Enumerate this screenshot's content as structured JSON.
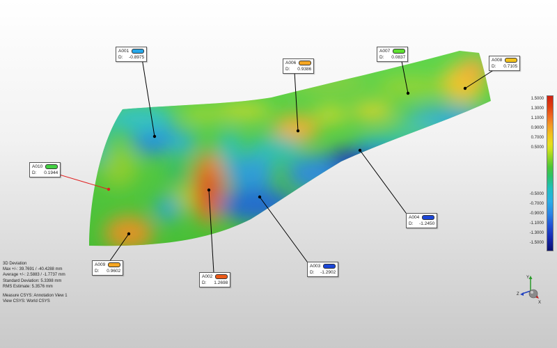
{
  "callouts": [
    {
      "id": "A001",
      "label": "A001",
      "d_label": "D:",
      "value": "-0.8975",
      "color": "#27a7e8"
    },
    {
      "id": "A006",
      "label": "A006",
      "d_label": "D:",
      "value": "0.9386",
      "color": "#f5a623"
    },
    {
      "id": "A007",
      "label": "A007",
      "d_label": "D:",
      "value": "0.0837",
      "color": "#5ee030"
    },
    {
      "id": "A008",
      "label": "A008",
      "d_label": "D:",
      "value": "0.7105",
      "color": "#f2c21d"
    },
    {
      "id": "A010",
      "label": "A010",
      "d_label": "D:",
      "value": "0.1944",
      "color": "#44d043"
    },
    {
      "id": "A004",
      "label": "A004",
      "d_label": "D:",
      "value": "-1.2450",
      "color": "#1b46d8"
    },
    {
      "id": "A009",
      "label": "A009",
      "d_label": "D:",
      "value": "0.9602",
      "color": "#f5a623"
    },
    {
      "id": "A002",
      "label": "A002",
      "d_label": "D:",
      "value": "1.2698",
      "color": "#ec5a18"
    },
    {
      "id": "A003",
      "label": "A003",
      "d_label": "D:",
      "value": "-1.2902",
      "color": "#1b46d8"
    }
  ],
  "legend": {
    "labels": [
      "1.5000",
      "1.3000",
      "1.1000",
      "0.9000",
      "0.7000",
      "0.5000",
      "-0.5000",
      "-0.7000",
      "-0.9000",
      "-1.1000",
      "-1.3000",
      "-1.5000"
    ]
  },
  "stats": {
    "title": "3D Deviation",
    "max": "Max +/-: 39.7691 / -40.4288 mm",
    "average": "Average +/-: 2.5883 / -1.7737 mm",
    "std": "Standard Deviation: 5.3398 mm",
    "rms": "RMS Estimate: 5.3576 mm",
    "measure_csys": "Measure CSYS: Annotation View 1",
    "view_csys": "View CSYS: World CSYS"
  },
  "triad": {
    "x_label": "X",
    "y_label": "Y",
    "z_label": "Z"
  }
}
